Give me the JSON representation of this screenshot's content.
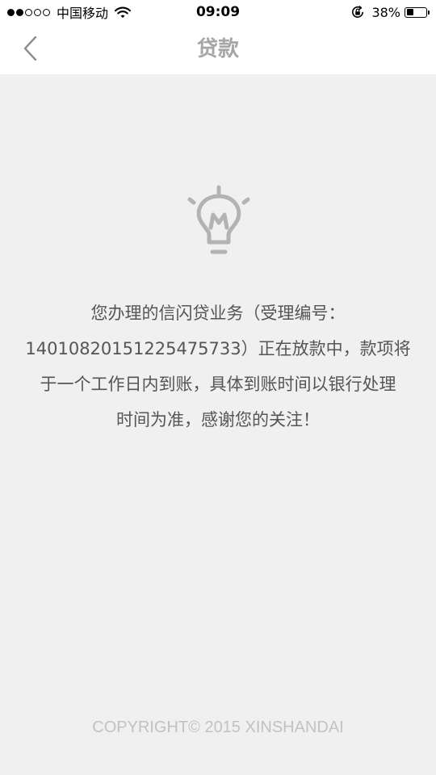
{
  "status_bar": {
    "signal_bars_filled": 2,
    "signal_bars_total": 5,
    "carrier": "中国移动",
    "time": "09:09",
    "battery_percent": "38%",
    "battery_level": 0.38
  },
  "nav": {
    "title": "贷款",
    "back_icon": "chevron-left-icon"
  },
  "content": {
    "icon": "lightbulb-icon",
    "message_lines": [
      "您办理的信闪贷业务（受理编号：",
      "14010820151225475733）正在放款中，款项将",
      "于一个工作日内到账，具体到账时间以银行处理",
      "时间为准，感谢您的关注！"
    ]
  },
  "footer": {
    "copyright": "COPYRIGHT© 2015 XINSHANDAI"
  },
  "colors": {
    "background": "#f0f0f0",
    "bar_background": "#ffffff",
    "title_text": "#a6a6a6",
    "message_text": "#555555",
    "footer_text": "#c2c2c2",
    "icon_gray": "#b3b3b3"
  }
}
